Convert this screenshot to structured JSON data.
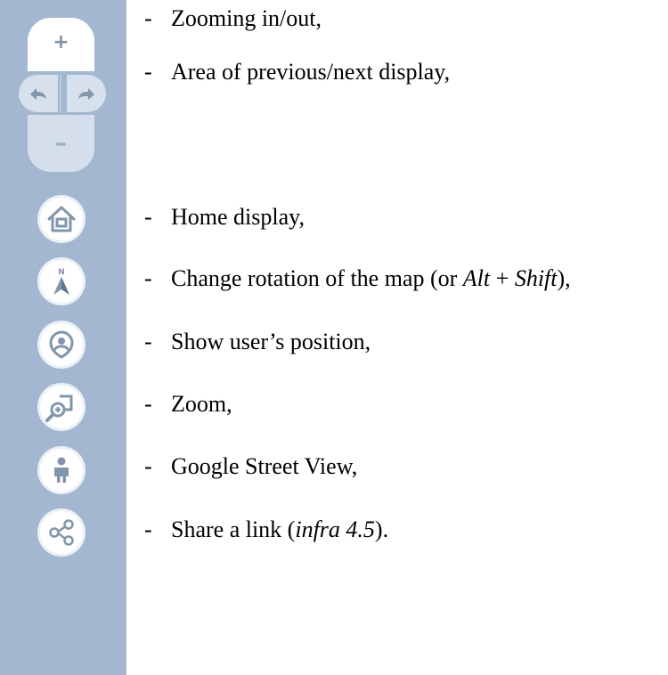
{
  "toolbar": {
    "zoom_in_symbol": "+",
    "zoom_out_symbol": "–",
    "north_letter": "N"
  },
  "legend": {
    "dash": "-",
    "items": [
      {
        "text": "Zooming in/out,"
      },
      {
        "text": "Area of previous/next display,"
      },
      {
        "text": "Home display,"
      },
      {
        "before": "Change rotation of the map (or ",
        "key1": "Alt",
        "plus": " + ",
        "key2": "Shift",
        "after": "),"
      },
      {
        "text": "Show user’s position,"
      },
      {
        "text": "Zoom,"
      },
      {
        "text": "Google Street View,"
      },
      {
        "before": "Share a link (",
        "ref": "infra 4.5",
        "after": ")."
      }
    ]
  },
  "colors": {
    "toolbar_background": "#a3b7d0",
    "button_face": "#ffffff",
    "icon_gray": "#8195ab"
  }
}
